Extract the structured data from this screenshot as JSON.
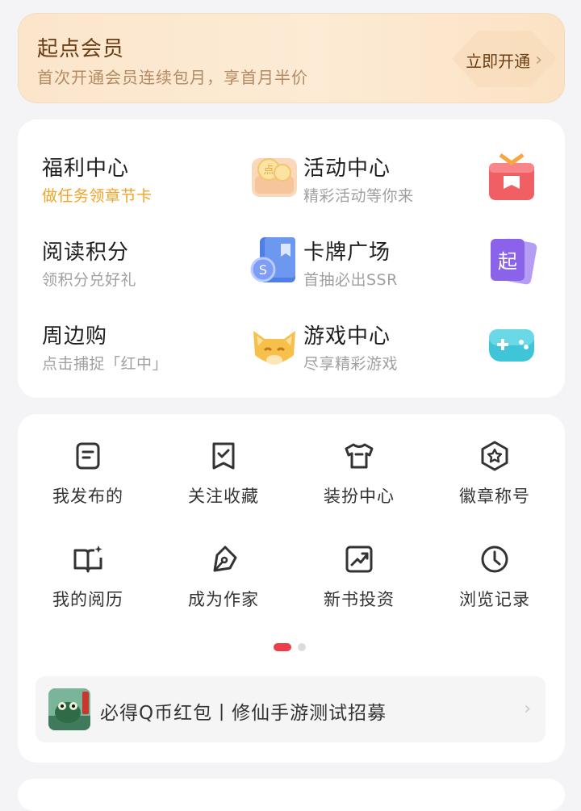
{
  "vip": {
    "title": "起点会员",
    "subtitle": "首次开通会员连续包月，享首月半价",
    "cta": "立即开通"
  },
  "features": [
    {
      "title": "福利中心",
      "subtitle": "做任务领章节卡",
      "icon": "coin-box-icon"
    },
    {
      "title": "活动中心",
      "subtitle": "精彩活动等你来",
      "icon": "gift-box-icon"
    },
    {
      "title": "阅读积分",
      "subtitle": "领积分兑好礼",
      "icon": "book-coin-icon"
    },
    {
      "title": "卡牌广场",
      "subtitle": "首抽必出SSR",
      "icon": "card-icon"
    },
    {
      "title": "周边购",
      "subtitle": "点击捕捉「红中」",
      "icon": "fox-icon"
    },
    {
      "title": "游戏中心",
      "subtitle": "尽享精彩游戏",
      "icon": "gamepad-icon"
    }
  ],
  "grid": [
    {
      "label": "我发布的",
      "icon": "document-icon"
    },
    {
      "label": "关注收藏",
      "icon": "bookmark-check-icon"
    },
    {
      "label": "装扮中心",
      "icon": "tshirt-icon"
    },
    {
      "label": "徽章称号",
      "icon": "badge-star-icon"
    },
    {
      "label": "我的阅历",
      "icon": "open-book-sparkle-icon"
    },
    {
      "label": "成为作家",
      "icon": "pen-nib-icon"
    },
    {
      "label": "新书投资",
      "icon": "trend-chart-icon"
    },
    {
      "label": "浏览记录",
      "icon": "clock-icon"
    }
  ],
  "pagination": {
    "pages": 2,
    "active": 1
  },
  "banner": {
    "text": "必得Q币红包丨修仙手游测试招募"
  },
  "colors": {
    "accent": "#ea3e4b",
    "vip_text": "#6b3d13",
    "orange_sub": "#f4a326"
  }
}
